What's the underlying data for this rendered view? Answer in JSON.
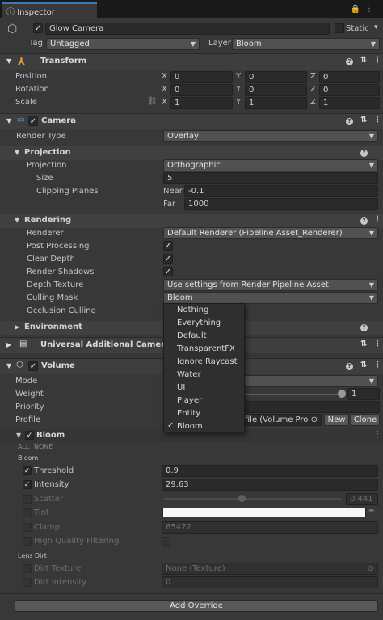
{
  "tab": {
    "title": "Inspector"
  },
  "object": {
    "name": "Glow Camera",
    "static_label": "Static",
    "tag_label": "Tag",
    "tag_value": "Untagged",
    "layer_label": "Layer",
    "layer_value": "Bloom"
  },
  "transform": {
    "title": "Transform",
    "rows": [
      {
        "label": "Position",
        "x": "0",
        "y": "0",
        "z": "0"
      },
      {
        "label": "Rotation",
        "x": "0",
        "y": "0",
        "z": "0"
      },
      {
        "label": "Scale",
        "x": "1",
        "y": "1",
        "z": "1"
      }
    ]
  },
  "camera": {
    "title": "Camera",
    "render_type_label": "Render Type",
    "render_type": "Overlay",
    "projection_title": "Projection",
    "projection_label": "Projection",
    "projection": "Orthographic",
    "size_label": "Size",
    "size": "5",
    "clipping_label": "Clipping Planes",
    "near_label": "Near",
    "near": "-0.1",
    "far_label": "Far",
    "far": "1000",
    "rendering_title": "Rendering",
    "renderer_label": "Renderer",
    "renderer": "Default Renderer (Pipeline Asset_Renderer)",
    "post_label": "Post Processing",
    "clear_label": "Clear Depth",
    "shadows_label": "Render Shadows",
    "depth_tex_label": "Depth Texture",
    "depth_tex": "Use settings from Render Pipeline Asset",
    "culling_label": "Culling Mask",
    "culling": "Bloom",
    "occlusion_label": "Occlusion Culling",
    "environment_title": "Environment"
  },
  "uacd": {
    "title": "Universal Additional Camera Dat"
  },
  "volume": {
    "title": "Volume",
    "mode_label": "Mode",
    "weight_label": "Weight",
    "weight": "1",
    "priority_label": "Priority",
    "profile_label": "Profile",
    "profile_value": "ofile (Volume Pro",
    "new_label": "New",
    "clone_label": "Clone"
  },
  "bloom": {
    "title": "Bloom",
    "all": "ALL",
    "none": "NONE",
    "section": "Bloom",
    "threshold_label": "Threshold",
    "threshold": "0.9",
    "intensity_label": "Intensity",
    "intensity": "29.63",
    "scatter_label": "Scatter",
    "scatter": "0.441",
    "tint_label": "Tint",
    "clamp_label": "Clamp",
    "clamp": "65472",
    "hq_label": "High Quality Filtering",
    "lens_dirt": "Lens Dirt",
    "dirt_tex_label": "Dirt Texture",
    "dirt_tex": "None (Texture)",
    "dirt_int_label": "Dirt Intensity",
    "dirt_int": "0"
  },
  "add_override": "Add Override",
  "menu": {
    "items": [
      "Nothing",
      "Everything",
      "Default",
      "TransparentFX",
      "Ignore Raycast",
      "Water",
      "UI",
      "Player",
      "Entity",
      "Bloom"
    ]
  },
  "colors": {
    "accent": "#3a79bb",
    "bg": "#383838"
  }
}
